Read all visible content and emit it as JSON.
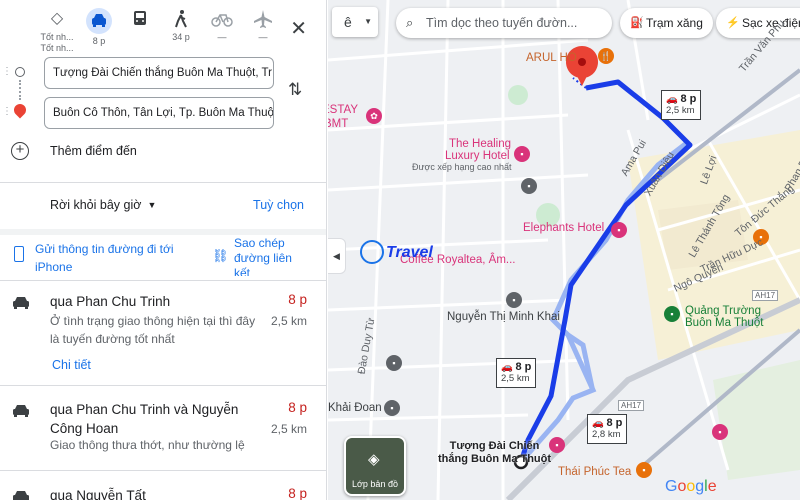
{
  "modes": [
    {
      "name": "mode-best",
      "icon": "diamond-turn-icon",
      "label": "Tốt nh..."
    },
    {
      "name": "mode-car",
      "icon": "car-icon",
      "label": "8 p"
    },
    {
      "name": "mode-transit",
      "icon": "bus-icon",
      "label": ""
    },
    {
      "name": "mode-walk",
      "icon": "walking-icon",
      "label": "34 p"
    },
    {
      "name": "mode-bike",
      "icon": "bicycle-icon",
      "label": "—"
    },
    {
      "name": "mode-flight",
      "icon": "airplane-icon",
      "label": "—"
    }
  ],
  "origin": "Tượng Đài Chiến thắng Buôn Ma Thuột, Tr",
  "destination": "Buôn Cô Thôn, Tân Lợi, Tp. Buôn Ma Thuột",
  "add_destination": "Thêm điểm đến",
  "depart": "Rời khỏi bây giờ",
  "options": "Tuỳ chọn",
  "send_to_phone": "Gửi thông tin đường đi tới iPhone",
  "copy_link": "Sao chép đường liên kết",
  "routes": [
    {
      "name": "qua Phan Chu Trinh",
      "time": "8 p",
      "distance": "2,5 km",
      "desc": "Ở tình trạng giao thông hiện tại thì đây là tuyến đường tốt nhất",
      "details": "Chi tiết"
    },
    {
      "name": "qua Phan Chu Trinh và Nguyễn Công Hoan",
      "time": "8 p",
      "distance": "2,5 km",
      "desc": "Giao thông thưa thớt, như thường lệ",
      "details": ""
    },
    {
      "name": "qua Nguyễn Tất",
      "time": "8 p",
      "distance": "",
      "desc": "",
      "details": ""
    }
  ],
  "map": {
    "search_placeholder": "Tìm dọc theo tuyến đườn...",
    "menu_glyph": "ê",
    "chips": [
      "Trạm xăng",
      "Sạc xe điện"
    ],
    "labels": {
      "arul": "ARUL HO",
      "estay": "ESTAY",
      "bmt": "BMT",
      "healing": "The Healing",
      "luxury": "Luxury Hotel",
      "healing_sub": "Được xếp hạng cao nhất",
      "elephants": "Elephants Hotel",
      "coffee": "Coffee Royaltea, Âm...",
      "nguyen_thi_minh_khai": "Nguyễn Thị Minh Khai",
      "quang_truong": "Quảng Trường",
      "quang_truong2": "Buôn Ma Thuột",
      "thai_phuc": "Thái Phúc Tea",
      "khai_doan": "Khải Đoan",
      "dest_line1": "Tượng Đài Chiến",
      "dest_line2": "thắng Buôn Ma Thuột",
      "tran_van_phu": "Trần Văn Phụ",
      "le_loi": "Lê Lợi",
      "le_thanh_tong": "Lê Thánh Tông",
      "tran_huu_duc": "Trần Hữu Dực",
      "ngo_quyen": "Ngô Quyền",
      "phan_boi_chau": "Phan Bội Châu",
      "ama_pui": "Ama Pui",
      "xuan_dieu": "Xuân Diệu",
      "ton_duc_thang": "Tôn Đức Thắng",
      "dao_duy_tu": "Đào Duy Từ",
      "ah17a": "AH17",
      "ah17b": "AH17",
      "google": "Google",
      "layers": "Lớp bản đồ",
      "watermark": "Travel"
    },
    "route_boxes": [
      {
        "time": "8 p",
        "dist": "2,5 km"
      },
      {
        "time": "8 p",
        "dist": "2,5 km"
      },
      {
        "time": "8 p",
        "dist": "2,8 km"
      }
    ],
    "colors": {
      "route_main": "#1a3de8",
      "route_alt": "#99b4f2",
      "accent": "#1a73e8",
      "time_red": "#c5221f"
    }
  }
}
